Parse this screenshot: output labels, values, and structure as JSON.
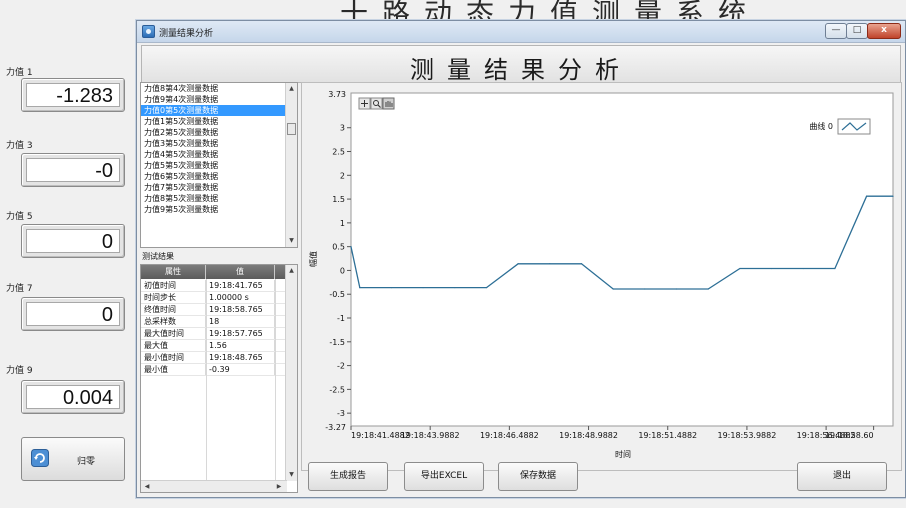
{
  "background_title": "十路动态力值测量系统",
  "left_panel": {
    "forces": [
      {
        "label": "力值 1",
        "value": "-1.283"
      },
      {
        "label": "力值 3",
        "value": "-0"
      },
      {
        "label": "力值 5",
        "value": "0"
      },
      {
        "label": "力值 7",
        "value": "0"
      },
      {
        "label": "力值 9",
        "value": "0.004"
      }
    ],
    "zero_button_label": "归零"
  },
  "window": {
    "title": "测量结果分析",
    "heading": "测量结果分析",
    "controls": {
      "minimize": "—",
      "maximize": "□",
      "close": "x"
    }
  },
  "data_list": {
    "items": [
      "力值8第4次测量数据",
      "力值9第4次测量数据",
      "力值0第5次测量数据",
      "力值1第5次测量数据",
      "力值2第5次测量数据",
      "力值3第5次测量数据",
      "力值4第5次测量数据",
      "力值5第5次测量数据",
      "力值6第5次测量数据",
      "力值7第5次测量数据",
      "力值8第5次测量数据",
      "力值9第5次测量数据"
    ],
    "selected_index": 2
  },
  "results": {
    "label": "测试结果",
    "columns": [
      "属性",
      "值"
    ],
    "rows": [
      {
        "key": "初值时间",
        "value": "19:18:41.765"
      },
      {
        "key": "时间步长",
        "value": "1.00000 s"
      },
      {
        "key": "终值时间",
        "value": "19:18:58.765"
      },
      {
        "key": "总采样数",
        "value": "18"
      },
      {
        "key": "最大值时间",
        "value": "19:18:57.765"
      },
      {
        "key": "最大值",
        "value": "1.56"
      },
      {
        "key": "最小值时间",
        "value": "19:18:48.765"
      },
      {
        "key": "最小值",
        "value": "-0.39"
      }
    ]
  },
  "buttons": {
    "report": "生成报告",
    "export": "导出EXCEL",
    "save": "保存数据",
    "exit": "退出"
  },
  "colors": {
    "series": "#2d6f96",
    "selection": "#3399ff",
    "table_header": "#6a6a6a"
  },
  "chart_data": {
    "type": "line",
    "xlabel": "时间",
    "ylabel": "幅值",
    "ylim": [
      -3.27,
      3.73
    ],
    "xlim": [
      0,
      17.112
    ],
    "x_tick_positions": [
      0,
      2.5,
      5,
      7.5,
      10,
      12.5,
      15,
      16.5
    ],
    "x_tick_labels": [
      "19:18:41.4882",
      "19:18:43.9882",
      "19:18:46.4882",
      "19:18:48.9882",
      "19:18:51.4882",
      "19:18:53.9882",
      "19:18:56.4882",
      "19:18:58.60"
    ],
    "y_ticks": [
      -3,
      -2.5,
      -2,
      -1.5,
      -1,
      -0.5,
      0,
      0.5,
      1,
      1.5,
      2,
      2.5,
      3
    ],
    "y_tick_labels": [
      "-3",
      "-2.5",
      "-2",
      "-1.5",
      "-1",
      "-0.5",
      "0",
      "0.5",
      "1",
      "1.5",
      "2",
      "2.5",
      "3"
    ],
    "y_min_label": "-3.27",
    "y_max_label": "3.73",
    "grid": false,
    "legend_position": "top-right",
    "series": [
      {
        "name": "曲线 0",
        "x": [
          0,
          0.277,
          1.277,
          2.277,
          3.277,
          4.277,
          5.277,
          6.277,
          7.277,
          8.277,
          9.277,
          10.277,
          11.277,
          12.277,
          13.277,
          14.277,
          15.277,
          16.277,
          17.112
        ],
        "values": [
          0.5,
          -0.36,
          -0.36,
          -0.36,
          -0.36,
          -0.36,
          0.14,
          0.14,
          0.14,
          -0.39,
          -0.39,
          -0.39,
          -0.39,
          0.04,
          0.04,
          0.04,
          0.04,
          1.56,
          1.56
        ]
      }
    ]
  }
}
